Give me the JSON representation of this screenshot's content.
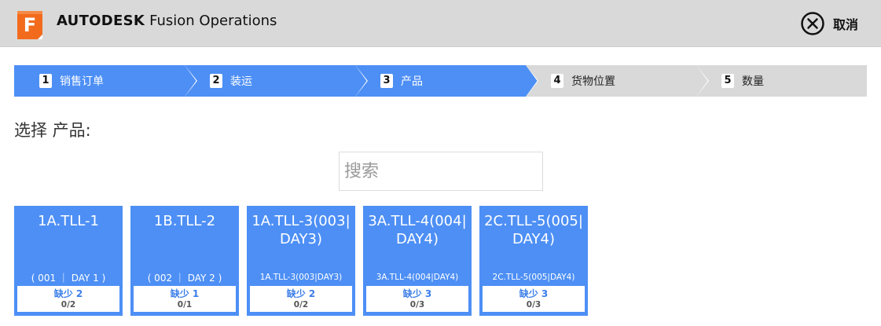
{
  "header": {
    "logo_letter": "F",
    "brand_bold": "AUTODESK",
    "brand_rest": "Fusion Operations",
    "cancel_label": "取消",
    "logo_color": "#f26b1d"
  },
  "steps": [
    {
      "num": "1",
      "label": "销售订单",
      "state": "active"
    },
    {
      "num": "2",
      "label": "装运",
      "state": "active"
    },
    {
      "num": "3",
      "label": "产品",
      "state": "active"
    },
    {
      "num": "4",
      "label": "货物位置",
      "state": "inactive"
    },
    {
      "num": "5",
      "label": "数量",
      "state": "inactive"
    }
  ],
  "step_colors": {
    "active": "#4d8ff5",
    "inactive": "#d9d9d9"
  },
  "page": {
    "heading": "选择 产品:",
    "search_placeholder": "搜索"
  },
  "products": [
    {
      "title": "1A.TLL-1",
      "subtitle": "( 001 ｜ DAY 1 )",
      "shortage": "缺少 2",
      "ratio": "0/2"
    },
    {
      "title": "1B.TLL-2",
      "subtitle": "( 002 ｜ DAY 2 )",
      "shortage": "缺少 1",
      "ratio": "0/1"
    },
    {
      "title": "1A.TLL-3(003|DAY3)",
      "subtitle": "1A.TLL-3(003|DAY3)",
      "shortage": "缺少 2",
      "ratio": "0/2"
    },
    {
      "title": "3A.TLL-4(004|DAY4)",
      "subtitle": "3A.TLL-4(004|DAY4)",
      "shortage": "缺少 3",
      "ratio": "0/3"
    },
    {
      "title": "2C.TLL-5(005|DAY4)",
      "subtitle": "2C.TLL-5(005|DAY4)",
      "shortage": "缺少 3",
      "ratio": "0/3"
    }
  ]
}
